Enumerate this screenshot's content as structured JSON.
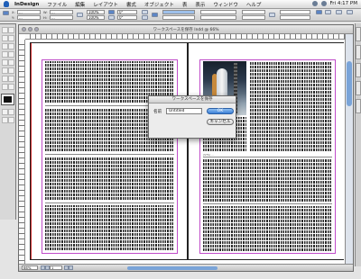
{
  "menubar": {
    "app_name": "InDesign",
    "items": [
      "ファイル",
      "編集",
      "レイアウト",
      "書式",
      "オブジェクト",
      "表",
      "表示",
      "ウィンドウ",
      "ヘルプ"
    ],
    "clock": "Fri 4:17 PM"
  },
  "control": {
    "x_value": "...",
    "y_value": "...",
    "w_value": "...",
    "h_value": "...",
    "scale_x": "100%",
    "scale_y": "100%",
    "angle": "0°",
    "shear": "0°"
  },
  "document": {
    "title": "ワークスペースを保存 Indd @ 66%",
    "zoom": "66%",
    "page": "1",
    "photo_caption": "(STS) ...",
    "colors": {
      "margin_guide": "#c04cc9",
      "bleed_guide": "#cc2b2b"
    }
  },
  "dialog": {
    "title": "ワークスペースを保存",
    "name_label": "名前",
    "name_value": "Untitled",
    "ok_label": "OK",
    "cancel_label": "キャンセル"
  }
}
